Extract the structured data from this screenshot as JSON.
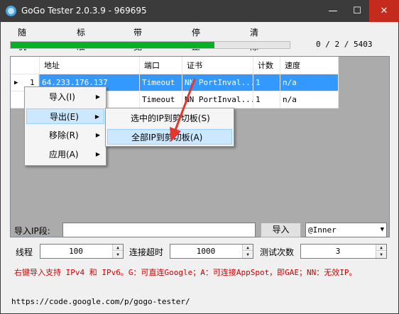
{
  "window": {
    "title": "GoGo Tester 2.0.3.9 - 969695",
    "minimize_glyph": "—",
    "maximize_glyph": "☐",
    "close_glyph": "✕"
  },
  "menu": [
    "随机测试(R)",
    "标准测试(S)",
    "带宽测试(B)",
    "停止测试(T)",
    "清除测试缓存(C)"
  ],
  "progress": {
    "text": "0 / 2 / 5403",
    "value": 0.73,
    "color": "#06b025"
  },
  "grid": {
    "headers": [
      "地址",
      "端口",
      "证书",
      "计数",
      "速度"
    ],
    "rows": [
      {
        "num": "1",
        "marker": "▶",
        "cells": [
          "64.233.176.137",
          "Timeout",
          "NN PortInval...",
          "1",
          "n/a"
        ],
        "selected": true
      },
      {
        "num": "",
        "marker": "",
        "cells": [
          "",
          "Timeout",
          "NN PortInval...",
          "1",
          "n/a"
        ],
        "selected": false
      }
    ]
  },
  "context_menu": {
    "items": [
      "导入(I)",
      "导出(E)",
      "移除(R)",
      "应用(A)"
    ],
    "arrow": "▶",
    "submenu": [
      "选中的IP到剪切板(S)",
      "全部IP到剪切板(A)"
    ]
  },
  "controls": {
    "import_label": "导入IP段:",
    "import_value": "",
    "import_button": "导入",
    "combo_value": "@Inner",
    "combo_arrow": "▼",
    "threads_label": "线程",
    "threads_value": "100",
    "timeout_label": "连接超时",
    "timeout_value": "1000",
    "tests_label": "测试次数",
    "tests_value": "3",
    "spin_up": "▲",
    "spin_down": "▼"
  },
  "hint": "右键导入支持 IPv4 和 IPv6。G：可直连Google；A：可连接AppSpot，即GAE；NN：无效IP。",
  "url": "https://code.google.com/p/gogo-tester/",
  "colors": {
    "selection": "#3399ff",
    "hint": "#d00000",
    "arrow": "#e8352b",
    "titlebar": "#3b3b3b"
  }
}
